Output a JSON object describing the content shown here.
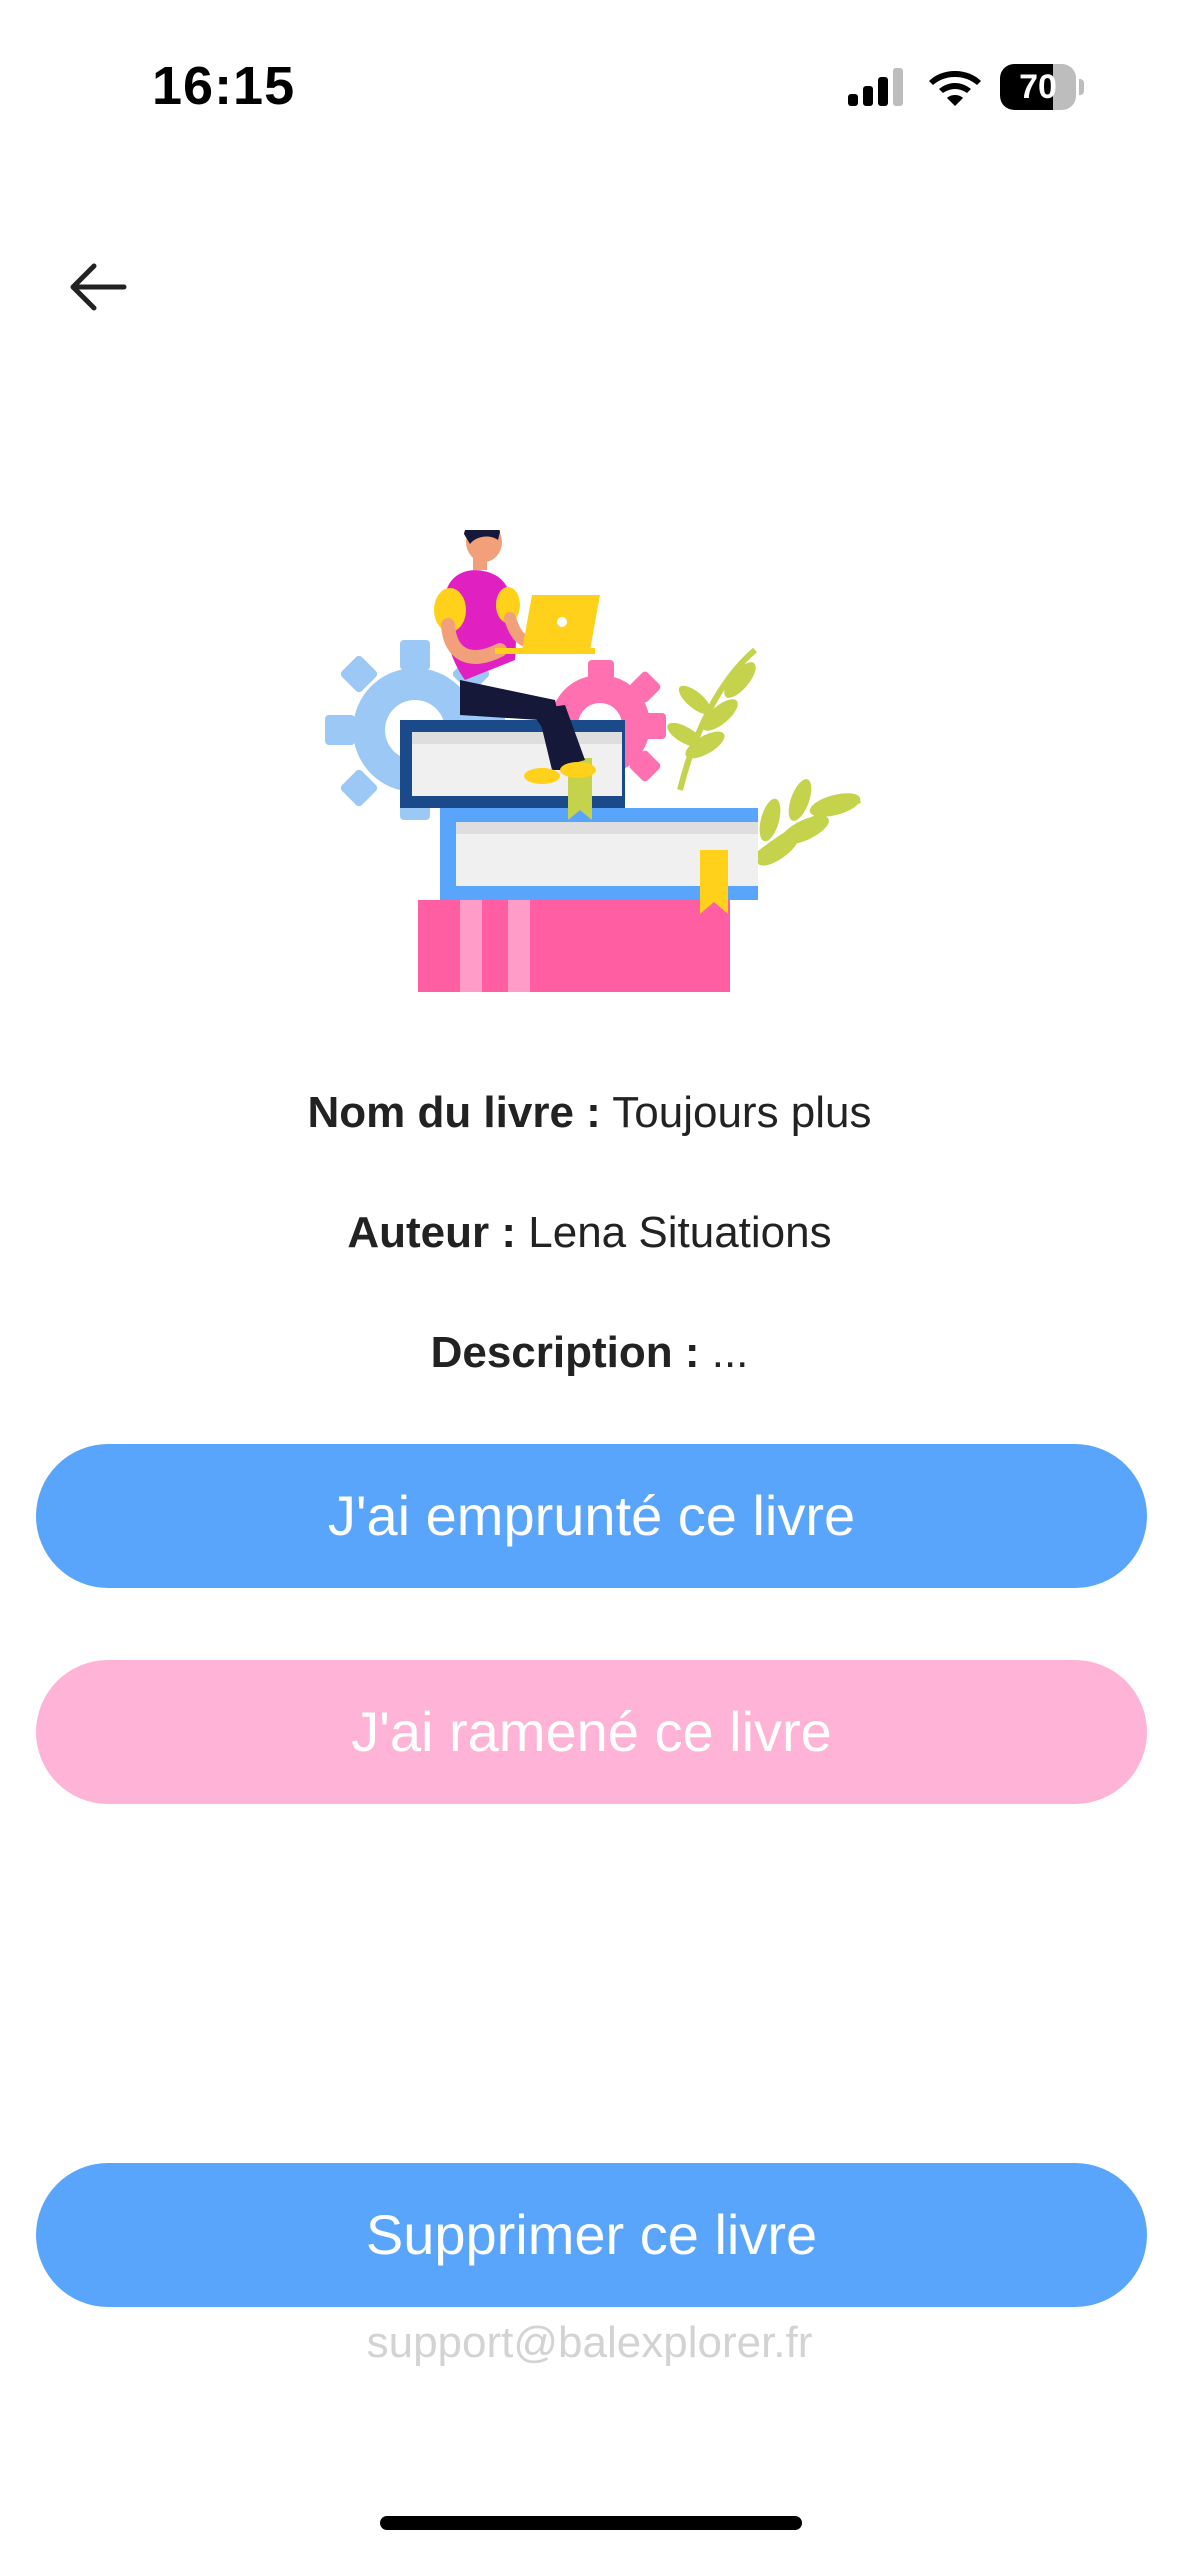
{
  "status_bar": {
    "time": "16:15",
    "battery": "70",
    "battery_level": 0.7,
    "icons": [
      "signal-icon",
      "wifi-icon",
      "battery-icon"
    ]
  },
  "navigation": {
    "back_icon": "arrow-left-icon"
  },
  "illustration": {
    "icon": "person-on-books-illustration",
    "colors": {
      "blue": "#5aa5fc",
      "pink": "#ff5fa2",
      "green": "#c5d24b",
      "yellow": "#ffd11a",
      "magenta": "#e020c0"
    }
  },
  "book": {
    "name_label": "Nom du livre :",
    "name_value": "Toujours plus",
    "author_label": "Auteur :",
    "author_value": "Lena Situations",
    "description_label": "Description :",
    "description_value": "..."
  },
  "actions": {
    "borrow_label": "J'ai emprunté ce livre",
    "return_label": "J'ai ramené ce livre",
    "delete_label": "Supprimer ce livre"
  },
  "footer": {
    "support_email": "support@balexplorer.fr"
  },
  "colors": {
    "primary": "#5aa5fc",
    "secondary": "#ffb3d6",
    "muted_text": "#d3d3d3"
  }
}
